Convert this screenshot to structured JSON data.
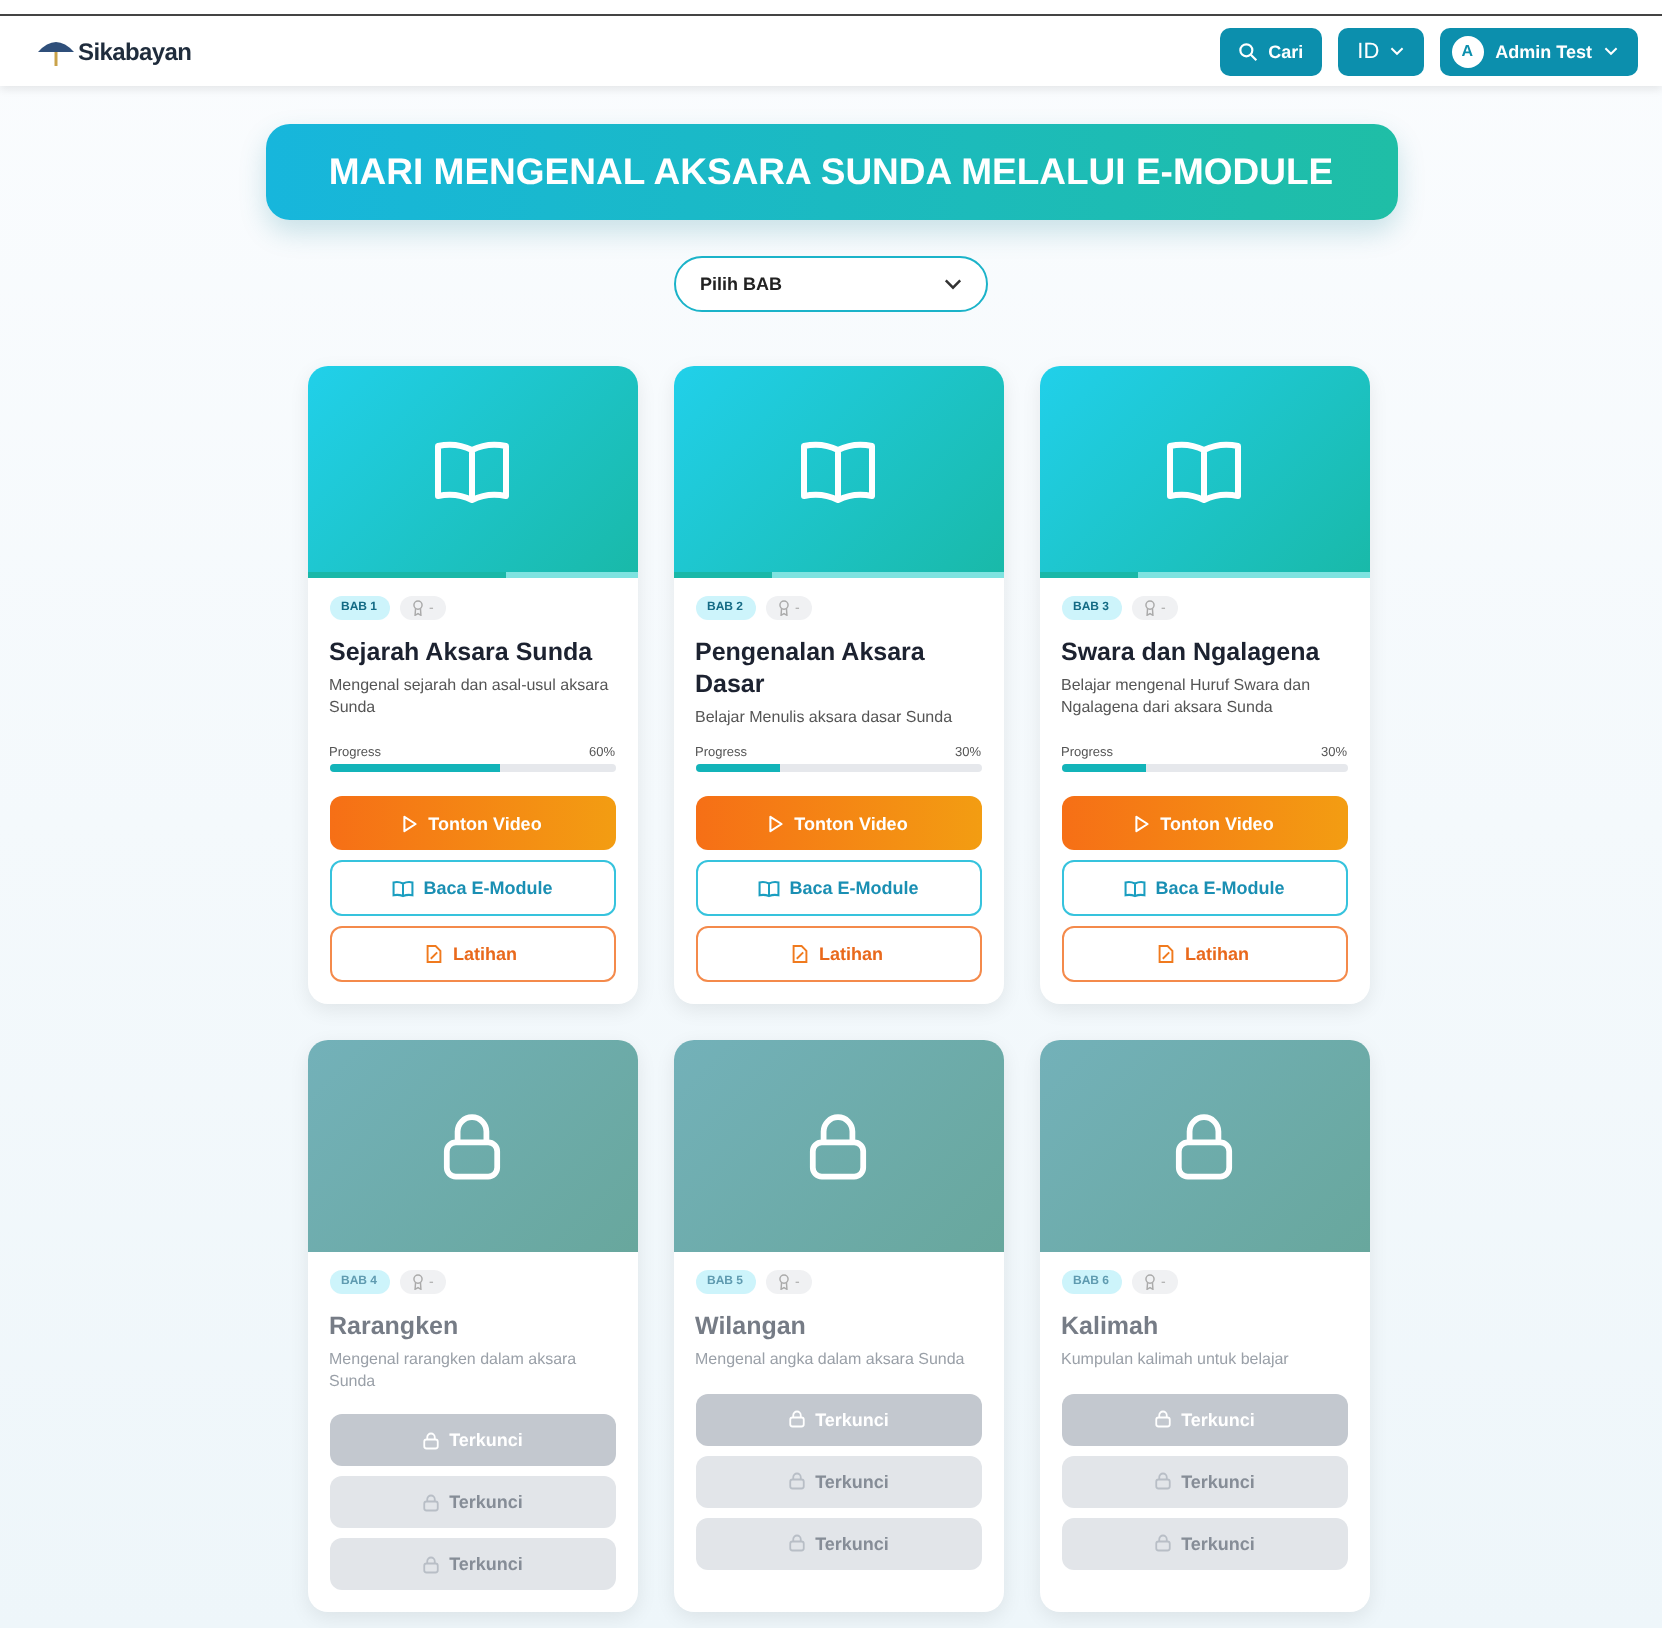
{
  "header": {
    "logo": "Sikabayan",
    "search_button": "Cari",
    "language": "ID",
    "user": {
      "initial": "A",
      "name": "Admin Test"
    }
  },
  "banner": {
    "title": "MARI MENGENAL AKSARA SUNDA MELALUI E-MODULE"
  },
  "chapter_select": {
    "value": "Pilih BAB"
  },
  "chapters": [
    {
      "badge": "BAB 1",
      "award": "-",
      "title": "Sejarah Aksara Sunda",
      "description": "Mengenal sejarah dan asal-usul aksara Sunda",
      "locked": false,
      "progress_label": "Progress",
      "progress_value": "60%",
      "level": 0.6,
      "buttons": [
        {
          "kind": "video",
          "label": "Tonton Video"
        },
        {
          "kind": "read",
          "label": "Baca E-Module"
        },
        {
          "kind": "exercise",
          "label": "Latihan"
        }
      ]
    },
    {
      "badge": "BAB 2",
      "award": "-",
      "title": "Pengenalan Aksara Dasar",
      "description": "Belajar Menulis aksara dasar Sunda",
      "locked": false,
      "progress_label": "Progress",
      "progress_value": "30%",
      "level": 0.3,
      "buttons": [
        {
          "kind": "video",
          "label": "Tonton Video"
        },
        {
          "kind": "read",
          "label": "Baca E-Module"
        },
        {
          "kind": "exercise",
          "label": "Latihan"
        }
      ]
    },
    {
      "badge": "BAB 3",
      "award": "-",
      "title": "Swara dan Ngalagena",
      "description": "Belajar mengenal Huruf Swara dan Ngalagena dari aksara Sunda",
      "locked": false,
      "progress_label": "Progress",
      "progress_value": "30%",
      "level": 0.3,
      "buttons": [
        {
          "kind": "video",
          "label": "Tonton Video"
        },
        {
          "kind": "read",
          "label": "Baca E-Module"
        },
        {
          "kind": "exercise",
          "label": "Latihan"
        }
      ]
    },
    {
      "badge": "BAB 4",
      "award": "-",
      "title": "Rarangken",
      "description": "Mengenal rarangken dalam aksara Sunda",
      "locked": true,
      "buttons": [
        {
          "kind": "locked_main",
          "label": "Terkunci"
        },
        {
          "kind": "locked",
          "label": "Terkunci"
        },
        {
          "kind": "locked",
          "label": "Terkunci"
        }
      ]
    },
    {
      "badge": "BAB 5",
      "award": "-",
      "title": "Wilangan",
      "description": "Mengenal angka dalam aksara Sunda",
      "locked": true,
      "buttons": [
        {
          "kind": "locked_main",
          "label": "Terkunci"
        },
        {
          "kind": "locked",
          "label": "Terkunci"
        },
        {
          "kind": "locked",
          "label": "Terkunci"
        }
      ]
    },
    {
      "badge": "BAB 6",
      "award": "-",
      "title": "Kalimah",
      "description": "Kumpulan kalimah untuk belajar",
      "locked": true,
      "buttons": [
        {
          "kind": "locked_main",
          "label": "Terkunci"
        },
        {
          "kind": "locked",
          "label": "Terkunci"
        },
        {
          "kind": "locked",
          "label": "Terkunci"
        }
      ]
    }
  ]
}
